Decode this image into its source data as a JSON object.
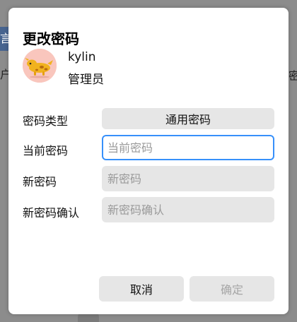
{
  "background": {
    "left_strip_char": "言",
    "left_text_char": "户",
    "right_text_char": "密"
  },
  "dialog": {
    "title": "更改密码",
    "user": {
      "name": "kylin",
      "role": "管理员",
      "avatar_icon": "cartoon-animal-avatar-icon"
    },
    "form": {
      "type_label": "密码类型",
      "type_value": "通用密码",
      "current_label": "当前密码",
      "current_placeholder": "当前密码",
      "new_label": "新密码",
      "new_placeholder": "新密码",
      "confirm_label": "新密码确认",
      "confirm_placeholder": "新密码确认"
    },
    "buttons": {
      "cancel": "取消",
      "ok": "确定"
    }
  },
  "colors": {
    "accent": "#3790fa",
    "field_bg": "#e6e6e6",
    "avatar_bg": "#f9c6bd"
  }
}
